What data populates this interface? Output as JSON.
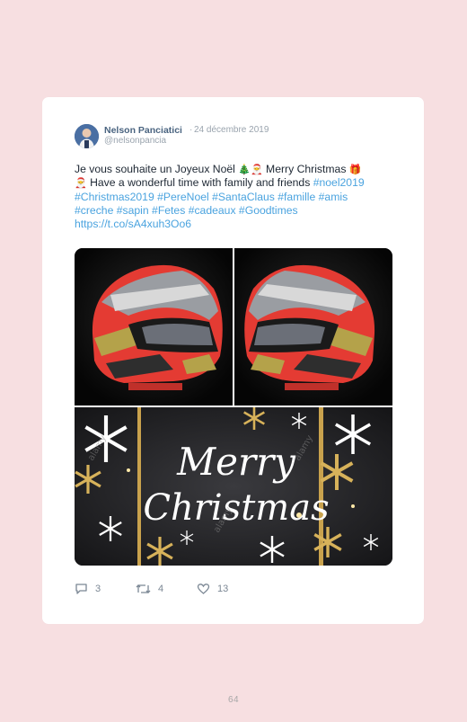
{
  "tweet": {
    "author_name": "Nelson Panciatici",
    "separator": "·",
    "date": "24 décembre 2019",
    "handle": "@nelsonpancia",
    "text_part1": "Je vous souhaite un Joyeux Noël ",
    "emoji_tree": "🎄",
    "emoji_santa": "🎅",
    "text_part2": " Merry Christmas ",
    "emoji_gift": "🎁",
    "text_part3": " Have a wonderful time with family and friends ",
    "hashtags_line1": "#noel2019",
    "hashtags_line2": "#Christmas2019 #PereNoel #SantaClaus #famille #amis",
    "hashtags_line3": "#creche #sapin #Fetes #cadeaux #Goodtimes",
    "link": "https://t.co/sA4xuh3Oo6",
    "images": [
      {
        "icon": "helmet-photo-left"
      },
      {
        "icon": "helmet-photo-right"
      },
      {
        "icon": "merry-christmas-card",
        "text_line1": "Merry",
        "text_line2": "Christmas",
        "watermark": "alamy"
      }
    ],
    "replies": "3",
    "retweets": "4",
    "likes": "13"
  },
  "page_number": "64",
  "colors": {
    "page_bg": "#f7dfe1",
    "card_bg": "#ffffff",
    "link": "#4aa3df",
    "name": "#4a6480",
    "meta": "#9aa4ae",
    "helmet_red": "#e43b33",
    "helmet_gold": "#b4a24a"
  }
}
